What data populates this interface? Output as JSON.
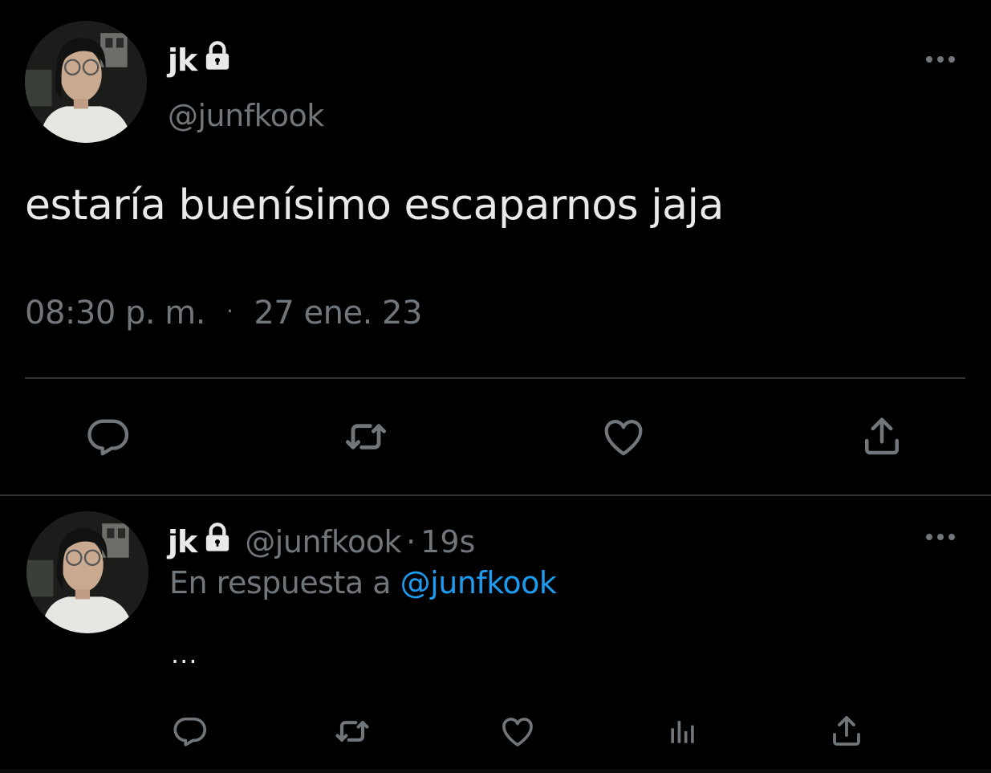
{
  "colors": {
    "background": "#000000",
    "text_primary": "#e7e9ea",
    "text_secondary": "#71767b",
    "link": "#1d9bf0",
    "divider": "#2f3336"
  },
  "main_tweet": {
    "display_name": "jk",
    "handle": "@junfkook",
    "protected_icon": "lock-icon",
    "text": "estaría buenísimo escaparnos jaja",
    "time": "08:30 p. m.",
    "separator": "·",
    "date": "27 ene. 23",
    "actions": [
      "reply-icon",
      "retweet-icon",
      "like-icon",
      "share-icon"
    ]
  },
  "reply_tweet": {
    "display_name": "jk",
    "handle": "@junfkook",
    "time_separator": "·",
    "relative_time": "19s",
    "replying_prefix": "En respuesta a",
    "replying_to": "@junfkook",
    "text": "...",
    "actions": [
      "reply-icon",
      "retweet-icon",
      "like-icon",
      "analytics-icon",
      "share-icon"
    ]
  }
}
